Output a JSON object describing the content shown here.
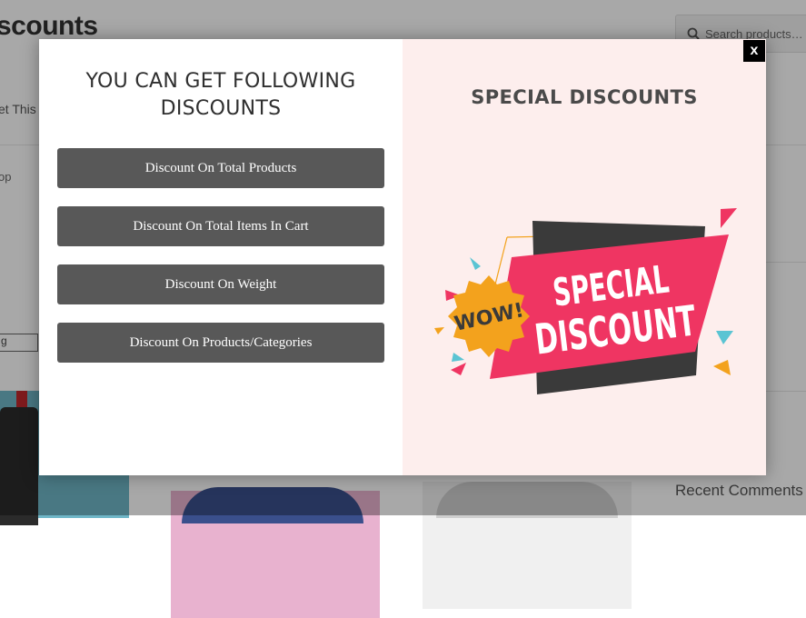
{
  "background": {
    "title": "scounts",
    "search_placeholder": "Search products…",
    "text1": "et This",
    "text2": "op",
    "select_value": "g",
    "recent_heading": "Recent Comments"
  },
  "modal": {
    "left": {
      "heading_line1": "YOU CAN GET FOLLOWING",
      "heading_line2": "DISCOUNTS",
      "buttons": [
        {
          "label": "Discount On Total Products"
        },
        {
          "label": "Discount On Total Items In Cart"
        },
        {
          "label": "Discount On Weight"
        },
        {
          "label": "Discount On Products/Categories"
        }
      ]
    },
    "right": {
      "heading": "SPECIAL DISCOUNTS",
      "banner": {
        "badge_text": "WOW!",
        "line1": "SPECIAL",
        "line2": "DISCOUNT"
      }
    },
    "close_label": "x"
  },
  "colors": {
    "button_bg": "#585858",
    "right_panel_bg": "#fdeeed",
    "banner_pink": "#ef3562",
    "badge_orange": "#f3a21d",
    "banner_dark": "#3a3a3a"
  },
  "icons": {
    "search": "search-icon",
    "close": "close-icon"
  }
}
